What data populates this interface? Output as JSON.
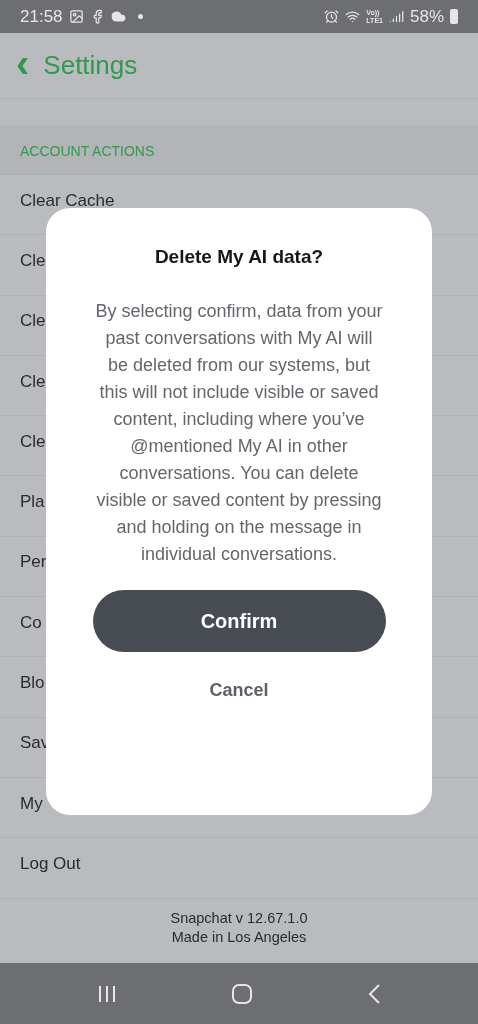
{
  "status_bar": {
    "time": "21:58",
    "network_top": "Vo))",
    "network_bottom": "LTE1",
    "battery": "58%"
  },
  "header": {
    "back": "‹",
    "title": "Settings"
  },
  "section": {
    "title": "ACCOUNT ACTIONS"
  },
  "rows": [
    {
      "label": "Clear Cache"
    },
    {
      "label": "Cle"
    },
    {
      "label": "Cle"
    },
    {
      "label": "Cle"
    },
    {
      "label": "Cle"
    },
    {
      "label": "Pla"
    },
    {
      "label": "Per"
    },
    {
      "label": "Co"
    },
    {
      "label": "Blo"
    },
    {
      "label": "Sav"
    },
    {
      "label": "My"
    },
    {
      "label": "Log Out"
    }
  ],
  "footer": {
    "version": "Snapchat v 12.67.1.0",
    "made_in": "Made in Los Angeles"
  },
  "dialog": {
    "title": "Delete My AI data?",
    "body": "By selecting confirm, data from your past conversations with My AI will be deleted from our systems, but this will not include visible or saved content, including where you’ve @mentioned My AI in other conversations. You can delete visible or saved content by pressing and holding on the message in individual conversations.",
    "confirm": "Confirm",
    "cancel": "Cancel"
  }
}
